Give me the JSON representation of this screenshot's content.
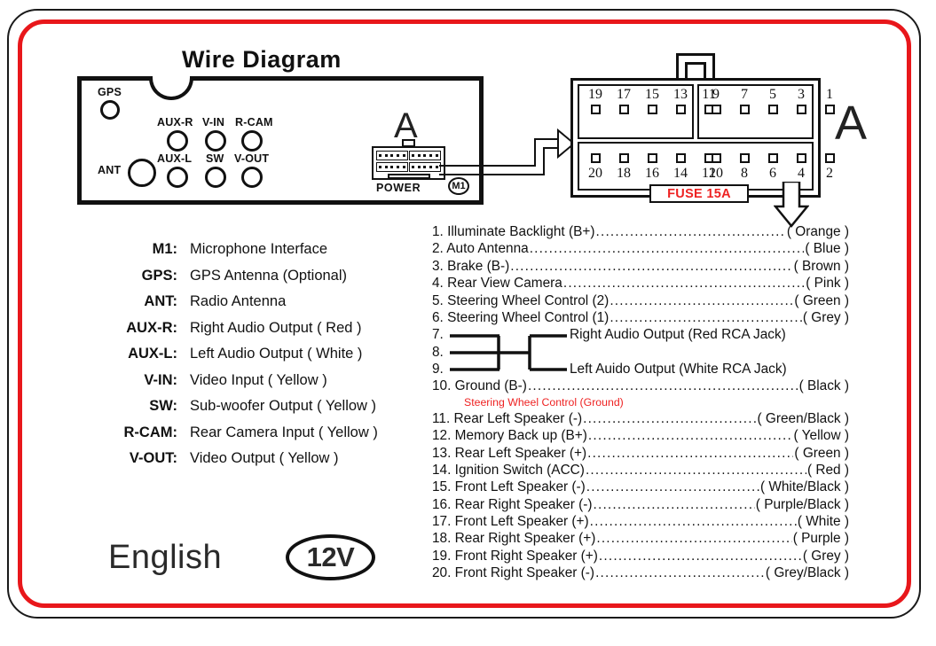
{
  "title": "Wire Diagram",
  "unit": {
    "letter_a_small": "A",
    "letter_a_big": "A",
    "power_label": "POWER",
    "m1_badge": "M1",
    "jacks": [
      {
        "name": "GPS",
        "label": "GPS"
      },
      {
        "name": "ANT",
        "label": "ANT"
      },
      {
        "name": "AUX-R",
        "label": "AUX-R"
      },
      {
        "name": "V-IN",
        "label": "V-IN"
      },
      {
        "name": "R-CAM",
        "label": "R-CAM"
      },
      {
        "name": "AUX-L",
        "label": "AUX-L"
      },
      {
        "name": "SW",
        "label": "SW"
      },
      {
        "name": "V-OUT",
        "label": "V-OUT"
      }
    ]
  },
  "connector": {
    "top_left_pins": [
      "19",
      "17",
      "15",
      "13",
      "11"
    ],
    "top_right_pins": [
      "9",
      "7",
      "5",
      "3",
      "1"
    ],
    "bottom_left_pins": [
      "20",
      "18",
      "16",
      "14",
      "12"
    ],
    "bottom_right_pins": [
      "10",
      "8",
      "6",
      "4",
      "2"
    ],
    "fuse_label": "FUSE 15A",
    "fuse_color": "#ee2222"
  },
  "legend": [
    {
      "key": "M1:",
      "value": "Microphone Interface"
    },
    {
      "key": "GPS:",
      "value": "GPS Antenna (Optional)"
    },
    {
      "key": "ANT:",
      "value": "Radio Antenna"
    },
    {
      "key": "AUX-R:",
      "value": "Right Audio Output ( Red )"
    },
    {
      "key": "AUX-L:",
      "value": "Left Audio Output ( White )"
    },
    {
      "key": "V-IN:",
      "value": "Video Input ( Yellow )"
    },
    {
      "key": "SW:",
      "value": "Sub-woofer Output ( Yellow )"
    },
    {
      "key": "R-CAM:",
      "value": "Rear Camera Input ( Yellow )"
    },
    {
      "key": "V-OUT:",
      "value": "Video Output ( Yellow )"
    }
  ],
  "footer": {
    "language": "English",
    "voltage": "12V"
  },
  "pinlist": {
    "rows_top": [
      {
        "label": "1. Illuminate Backlight (B+)",
        "color": "( Orange )"
      },
      {
        "label": "2. Auto Antenna",
        "color": "( Blue )"
      },
      {
        "label": "3. Brake (B-)",
        "color": "( Brown )"
      },
      {
        "label": "4. Rear View Camera",
        "color": "( Pink )"
      },
      {
        "label": "5. Steering Wheel Control (2)",
        "color": "( Green )"
      },
      {
        "label": "6. Steering Wheel Control (1)",
        "color": "( Grey )"
      }
    ],
    "rca": {
      "n7": "7.",
      "n8": "8.",
      "n9": "9.",
      "right_text": "Right Audio Output (Red RCA Jack)",
      "left_text": "Left Auido Output (White RCA Jack)"
    },
    "ground": {
      "label": "10. Ground (B-)",
      "color": "( Black )"
    },
    "ground_note": "Steering Wheel Control (Ground)",
    "rows_bottom": [
      {
        "label": "11. Rear Left Speaker (-)",
        "color": "( Green/Black )"
      },
      {
        "label": "12. Memory Back up (B+)",
        "color": "( Yellow )"
      },
      {
        "label": "13. Rear Left Speaker (+)",
        "color": "( Green )"
      },
      {
        "label": "14. Ignition Switch (ACC)",
        "color": "( Red )"
      },
      {
        "label": "15. Front Left Speaker (-)",
        "color": "( White/Black )"
      },
      {
        "label": "16. Rear Right Speaker (-)",
        "color": "( Purple/Black )"
      },
      {
        "label": "17. Front Left Speaker (+)",
        "color": "( White )"
      },
      {
        "label": "18. Rear Right Speaker (+)",
        "color": "( Purple )"
      },
      {
        "label": "19. Front Right Speaker (+)",
        "color": "( Grey )"
      },
      {
        "label": "20. Front Right Speaker (-)",
        "color": "( Grey/Black )"
      }
    ],
    "dots": "..........................................................."
  }
}
